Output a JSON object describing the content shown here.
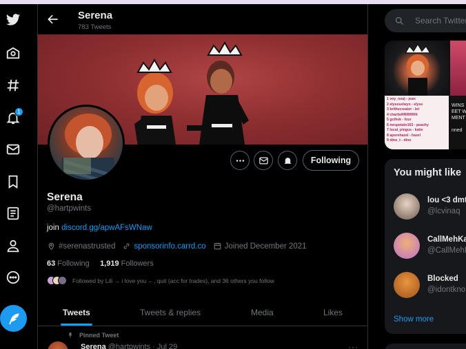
{
  "header": {
    "name": "Serena",
    "tweet_count": "783 Tweets"
  },
  "profile": {
    "display_name": "Serena",
    "handle": "@hartpwints",
    "bio_prefix": "join ",
    "bio_link": "discord.gg/apwAFsWNaw",
    "location": "#serenastrusted",
    "website": "sponsorinfo.carrd.co",
    "joined": "Joined December 2021",
    "following_count": "63",
    "following_label": " Following",
    "followers_count": "1,919",
    "followers_label": " Followers",
    "followed_by": "Followed by Lili → i love you ←, quit (acc for trades), and 36 others you follow",
    "follow_button": "Following"
  },
  "nav": {
    "notification_badge": "1"
  },
  "tabs": [
    {
      "label": "Tweets"
    },
    {
      "label": "Tweets & replies"
    },
    {
      "label": "Media"
    },
    {
      "label": "Likes"
    }
  ],
  "pinned_tweet": {
    "pinned_label": "Pinned Tweet",
    "author": "Serena",
    "handle_date": "@hartpwints · Jul 29",
    "more": "···"
  },
  "search": {
    "placeholder": "Search Twitter"
  },
  "media_preview": {
    "list_lines": [
      "1 voy_nea) - jean",
      "2 elyseselwyn - elyse",
      "3 brithecreator - bri",
      "4 charlieRRRRRfit",
      "5 gcthsk - four",
      "6 mrspotato163 - peachy",
      "7 local_pingus - katie",
      "8 aporehazel - hazel",
      "9 dino_t - dino"
    ],
    "side_lines": [
      "WINS",
      "EET W",
      "MENT",
      "",
      "nned"
    ]
  },
  "who_to_follow": {
    "title": "You might like",
    "items": [
      {
        "name": "lou <3 dmt",
        "handle": "@lcvinaq"
      },
      {
        "name": "CallMehKa",
        "handle": "@CallMehK"
      },
      {
        "name": "Blocked",
        "handle": "@idontkno"
      }
    ],
    "show_more": "Show more"
  },
  "colors": {
    "accent": "#1d9bf0",
    "background": "#000000",
    "muted": "#71767b",
    "banner": "#8f2f31"
  }
}
